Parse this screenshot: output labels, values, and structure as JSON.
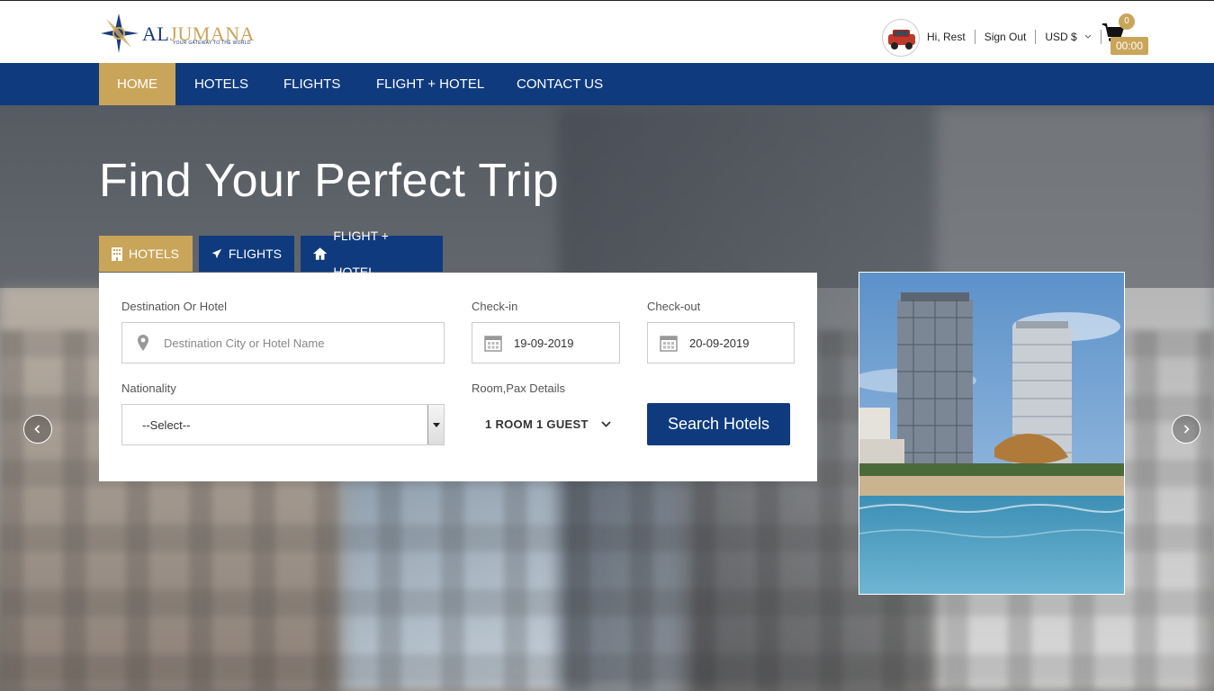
{
  "brand": {
    "name_part1": "AL",
    "name_part2": "JUMANA",
    "tagline": "YOUR GATEWAY TO THE WORLD"
  },
  "user": {
    "greeting": "Hi, Rest",
    "sign_out": "Sign Out",
    "currency": "USD $"
  },
  "cart": {
    "count": "0",
    "timer": "00:00"
  },
  "nav": {
    "items": [
      {
        "label": "HOME",
        "active": true
      },
      {
        "label": "HOTELS"
      },
      {
        "label": "FLIGHTS"
      },
      {
        "label": "FLIGHT + HOTEL"
      },
      {
        "label": "CONTACT US"
      }
    ]
  },
  "hero": {
    "title": "Find Your Perfect Trip"
  },
  "tabs": [
    {
      "label": "HOTELS",
      "icon": "building-icon",
      "active": true
    },
    {
      "label": "FLIGHTS",
      "icon": "plane-icon"
    },
    {
      "label": "FLIGHT + HOTEL",
      "icon": "home-icon"
    }
  ],
  "search": {
    "destination_label": "Destination Or Hotel",
    "destination_placeholder": "Destination City or Hotel Name",
    "checkin_label": "Check-in",
    "checkin_value": "19-09-2019",
    "checkout_label": "Check-out",
    "checkout_value": "20-09-2019",
    "nationality_label": "Nationality",
    "nationality_value": "--Select--",
    "pax_label": "Room,Pax Details",
    "pax_value": "1 ROOM 1 GUEST",
    "button": "Search Hotels"
  },
  "colors": {
    "primary": "#0f3a7e",
    "accent": "#c9a55a"
  }
}
